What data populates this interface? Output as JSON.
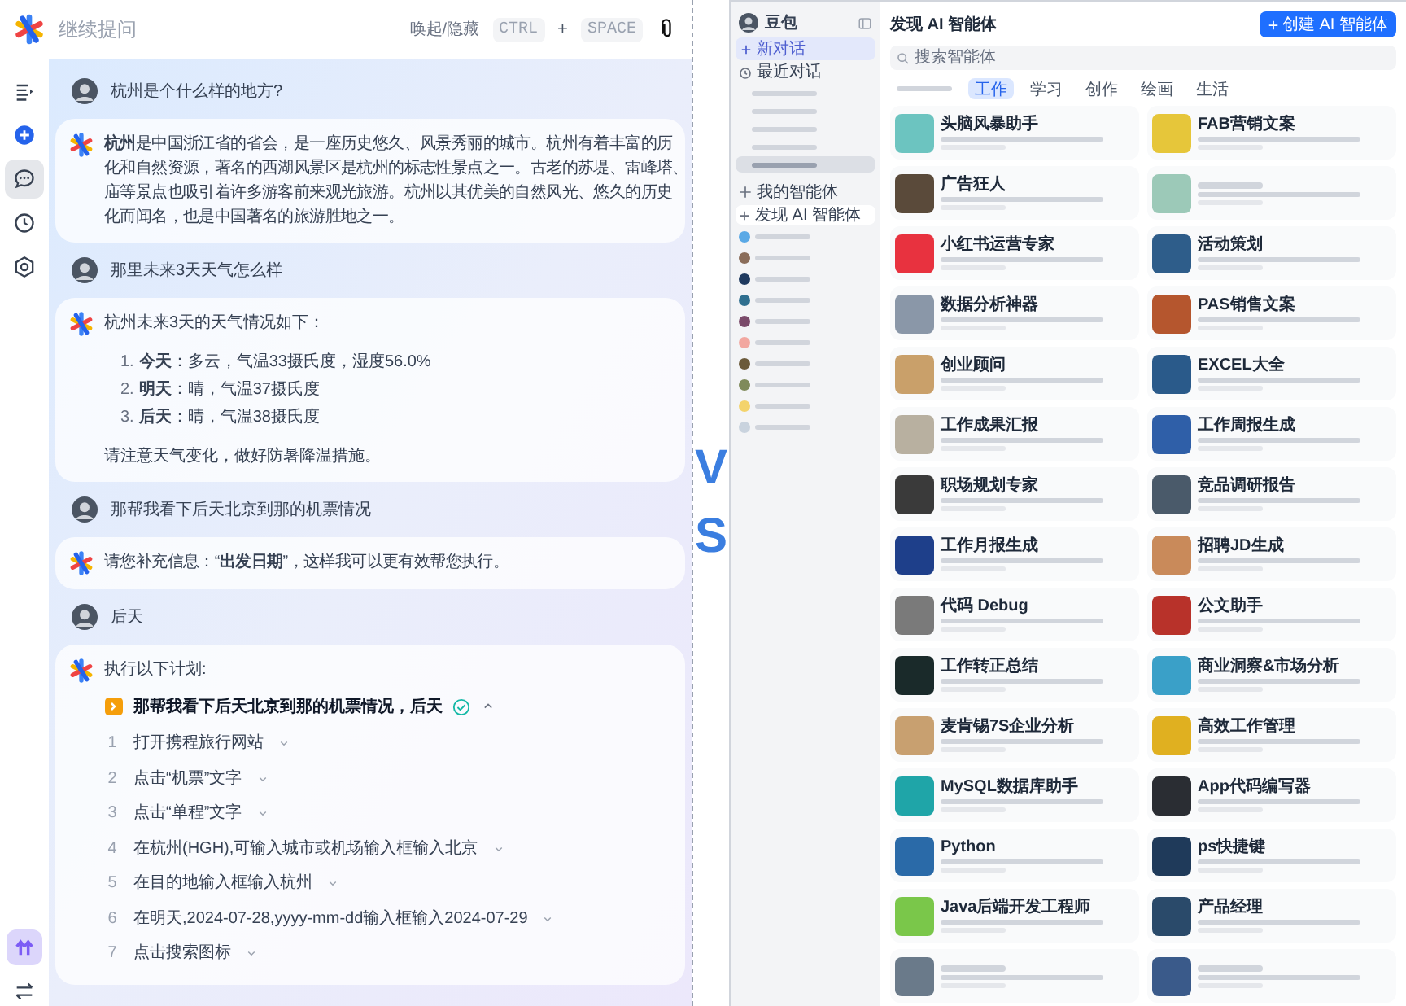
{
  "assistant": {
    "header": {
      "placeholder": "继续提问",
      "hint": "唤起/隐藏",
      "keys": [
        "CTRL",
        "SPACE"
      ],
      "key_joiner": "+"
    },
    "rail": [
      {
        "kind": "menu",
        "selected": false
      },
      {
        "kind": "new",
        "selected": false
      },
      {
        "kind": "chat",
        "selected": true
      },
      {
        "kind": "history",
        "selected": false
      },
      {
        "kind": "settings",
        "selected": false
      }
    ],
    "messages": [
      {
        "kind": "user",
        "text": "杭州是个什么样的地方?"
      },
      {
        "kind": "paragraph",
        "lines": [
          "**杭州**是中国浙江省的省会，是一座历史悠久、风景秀丽的城市。杭州有着丰富的历",
          "化和自然资源，著名的西湖风景区是杭州的标志性景点之一。古老的苏堤、雷峰塔、",
          "庙等景点也吸引着许多游客前来观光旅游。杭州以其优美的自然风光、悠久的历史",
          "化而闻名，也是中国著名的旅游胜地之一。"
        ]
      },
      {
        "kind": "user",
        "text": "那里未来3天天气怎么样"
      },
      {
        "kind": "list",
        "intro": "杭州未来3天的天气情况如下：",
        "items": [
          {
            "number": "1.",
            "text": "**今天**：多云，气温33摄氏度，湿度56.0%"
          },
          {
            "number": "2.",
            "text": "**明天**：晴，气温37摄氏度"
          },
          {
            "number": "3.",
            "text": "**后天**：晴，气温38摄氏度"
          }
        ],
        "note": "请注意天气变化，做好防暑降温措施。"
      },
      {
        "kind": "user",
        "text": "那帮我看下后天北京到那的机票情况"
      },
      {
        "kind": "paragraph",
        "lines": [
          "请您补充信息：“**出发日期**”，这样我可以更有效帮您执行。"
        ]
      },
      {
        "kind": "user",
        "text": "后天"
      },
      {
        "kind": "plan",
        "intro": "执行以下计划:",
        "title": "那帮我看下后天北京到那的机票情况，后天",
        "done": true,
        "expanded": true,
        "steps": [
          {
            "number": "1",
            "text": "打开携程旅行网站",
            "expanded": false
          },
          {
            "number": "2",
            "text": "点击“机票”文字",
            "expanded": false
          },
          {
            "number": "3",
            "text": "点击“单程”文字",
            "expanded": false
          },
          {
            "number": "4",
            "text": "在杭州(HGH),可输入城市或机场输入框输入北京",
            "expanded": false
          },
          {
            "number": "5",
            "text": "在目的地输入框输入杭州",
            "expanded": false
          },
          {
            "number": "6",
            "text": "在明天,2024-07-28,yyyy-mm-dd输入框输入2024-07-29",
            "expanded": false
          },
          {
            "number": "7",
            "text": "点击搜索图标",
            "expanded": false
          }
        ]
      }
    ]
  },
  "versus": "VS",
  "agents_app": {
    "sidebar": {
      "user": "豆包",
      "new_chat": "新对话",
      "recent_title": "最近对话",
      "recent": [
        {
          "selected": false
        },
        {
          "selected": false
        },
        {
          "selected": false
        },
        {
          "selected": false
        },
        {
          "selected": true
        }
      ],
      "agents_title": "我的智能体",
      "agents": [
        {
          "label": "发现 AI 智能体",
          "selected": true
        },
        {
          "color": "#5aa9e6",
          "selected": false
        },
        {
          "color": "#8a6d5a",
          "selected": false
        },
        {
          "color": "#1f3a5f",
          "selected": false
        },
        {
          "color": "#2f6f8f",
          "selected": false
        },
        {
          "color": "#7a4a6a",
          "selected": false
        },
        {
          "color": "#f2a7a0",
          "selected": false
        },
        {
          "color": "#6b5a3a",
          "selected": false
        },
        {
          "color": "#7f8a5a",
          "selected": false
        },
        {
          "color": "#f3d36b",
          "selected": false
        },
        {
          "color": "#c9d3de",
          "selected": false
        }
      ]
    },
    "main": {
      "title": "发现 AI 智能体",
      "create_button": "创建 AI 智能体",
      "search_placeholder": "搜索智能体",
      "tabs": [
        {
          "selected": false
        },
        {
          "label": "工作",
          "selected": true
        },
        {
          "label": "学习",
          "selected": false
        },
        {
          "label": "创作",
          "selected": false
        },
        {
          "label": "绘画",
          "selected": false
        },
        {
          "label": "生活",
          "selected": false
        }
      ],
      "cards": [
        {
          "title": "头脑风暴助手",
          "color": "#6cc4c0"
        },
        {
          "title": "FAB营销文案",
          "color": "#e6c63a"
        },
        {
          "title": "广告狂人",
          "color": "#5a4a3a"
        },
        {
          "color": "#9cc9b8"
        },
        {
          "title": "小红书运营专家",
          "color": "#e8323f"
        },
        {
          "title": "活动策划",
          "color": "#2e5d8a"
        },
        {
          "title": "数据分析神器",
          "color": "#8a97a8"
        },
        {
          "title": "PAS销售文案",
          "color": "#b5562e"
        },
        {
          "title": "创业顾问",
          "color": "#c9a06a"
        },
        {
          "title": "EXCEL大全",
          "color": "#2a5a8a"
        },
        {
          "title": "工作成果汇报",
          "color": "#b8b0a0"
        },
        {
          "title": "工作周报生成",
          "color": "#2f5fa8"
        },
        {
          "title": "职场规划专家",
          "color": "#3a3a3a"
        },
        {
          "title": "竞品调研报告",
          "color": "#4a5a6a"
        },
        {
          "title": "工作月报生成",
          "color": "#1e3f8a"
        },
        {
          "title": "招聘JD生成",
          "color": "#c98a5a"
        },
        {
          "title": "代码 Debug",
          "color": "#7a7a7a"
        },
        {
          "title": "公文助手",
          "color": "#b8322a"
        },
        {
          "title": "工作转正总结",
          "color": "#1a2a2a"
        },
        {
          "title": "商业洞察&市场分析",
          "color": "#3aa0c8"
        },
        {
          "title": "麦肯锡7S企业分析",
          "color": "#c8a070"
        },
        {
          "title": "高效工作管理",
          "color": "#e0b020"
        },
        {
          "title": "MySQL数据库助手",
          "color": "#1fa5a8"
        },
        {
          "title": "App代码编写器",
          "color": "#2a2d33"
        },
        {
          "title": "Python",
          "color": "#2a6aa8"
        },
        {
          "title": "ps快捷键",
          "color": "#1f3a5a"
        },
        {
          "title": "Java后端开发工程师",
          "color": "#7ac74a"
        },
        {
          "title": "产品经理",
          "color": "#2a4a6a"
        },
        {
          "color": "#6a7a8a"
        },
        {
          "color": "#3a5a8a"
        }
      ]
    }
  }
}
